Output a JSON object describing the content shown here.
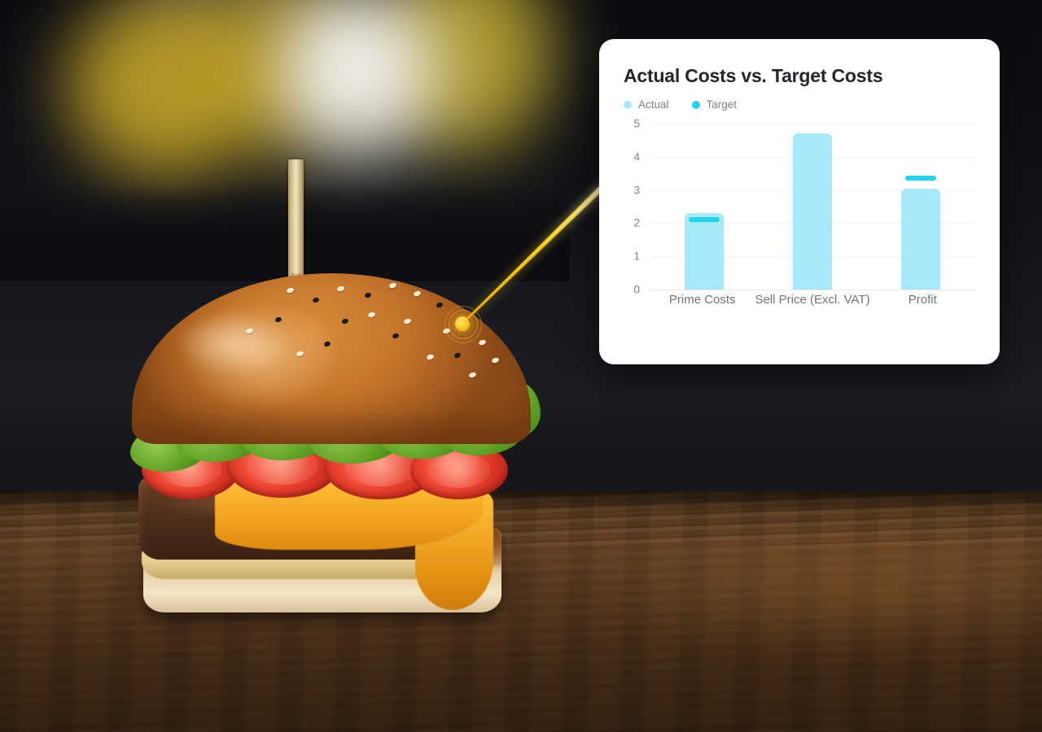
{
  "scene": {
    "subject": "cheeseburger-photo",
    "background_description": "dark blurred background with yellow bokeh over a dark wooden table"
  },
  "callout": {
    "hotspot_label": "chart-hotspot",
    "beam_color": "#F5C518",
    "hotspot_color": "#F4C21A"
  },
  "card": {
    "chart_data": {
      "type": "bar",
      "title": "Actual Costs vs. Target Costs",
      "xlabel": "",
      "ylabel": "",
      "categories": [
        "Prime Costs",
        "Sell Price (Excl. VAT)",
        "Profit"
      ],
      "series": [
        {
          "name": "Actual",
          "values": [
            2.3,
            4.7,
            3.05
          ],
          "color": "#A5E9FA",
          "marker": "bar"
        },
        {
          "name": "Target",
          "values": [
            2.1,
            null,
            3.35
          ],
          "color": "#22D3EE",
          "marker": "line"
        }
      ],
      "ylim": [
        0,
        5
      ],
      "yticks": [
        5,
        4,
        3,
        2,
        1,
        0
      ],
      "ytick_labels": [
        "5",
        "4",
        "3",
        "2",
        "1",
        "0"
      ],
      "grid": true,
      "legend_position": "top-left"
    }
  }
}
